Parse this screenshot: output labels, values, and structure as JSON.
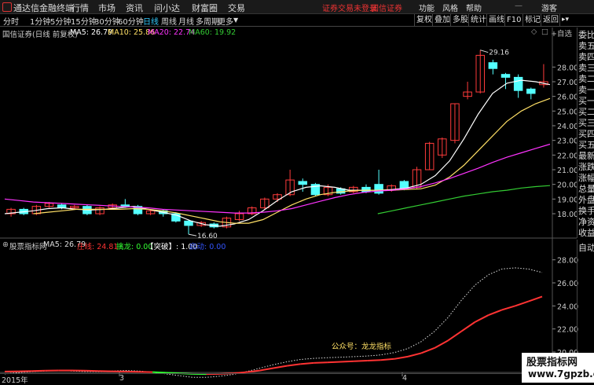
{
  "titlebar": {
    "app_name": "通达信金融终端",
    "menus": [
      "行情",
      "市场",
      "资讯",
      "问小达",
      "财富圈",
      "交易"
    ],
    "login_notice": "证券交易未登录",
    "broker": "国信证券",
    "right_items": [
      "功能",
      "风格",
      "帮助",
      "游客"
    ],
    "accent": "#e33333"
  },
  "toolbar": {
    "periods": [
      "分时",
      "1分钟",
      "5分钟",
      "15分钟",
      "30分钟",
      "60分钟",
      "日线",
      "周线",
      "月线",
      "多周期",
      "更多"
    ],
    "active_period": "日线",
    "right_buttons": [
      "复权",
      "叠加",
      "多股",
      "统计",
      "画线",
      "F10",
      "标记",
      "返回"
    ]
  },
  "main_chart": {
    "title": "国信证券(日线 前复权)",
    "legend": [
      {
        "label": "MA5: 26.79",
        "color": "#ffffff"
      },
      {
        "label": "MA10: 25.86",
        "color": "#ffe066"
      },
      {
        "label": "MA20: 22.74",
        "color": "#ff33ff"
      },
      {
        "label": "MA60: 19.92",
        "color": "#33cc33"
      }
    ],
    "high_label": "29.16",
    "low_label": "16.60"
  },
  "indicator_panel": {
    "title": "股票指标网",
    "legend": [
      {
        "label": "MA5: 26.79",
        "color": "#dddddd"
      },
      {
        "label": "庄线: 24.81",
        "color": "#ff3333"
      },
      {
        "label": "擒龙: 0.00",
        "color": "#33ff33"
      },
      {
        "label": "【突破】: 1.00",
        "color": "#ffffff"
      },
      {
        "label": "启动: 0.00",
        "color": "#3355ff"
      }
    ],
    "annotation": "公众号：龙龙指标"
  },
  "sidebar": {
    "items": [
      "委比",
      "卖五",
      "卖四",
      "卖三",
      "卖二",
      "卖一",
      "买一",
      "买二",
      "买三",
      "买四",
      "买五",
      "最新",
      "涨跌",
      "涨幅",
      "总量",
      "外盘",
      "换手",
      "净资",
      "收益"
    ],
    "bottom_label": "自动"
  },
  "bottom_axis": {
    "labels": [
      "2015年",
      "3",
      "4"
    ]
  },
  "watermark": {
    "line1": "股票指标网",
    "line2": "www.7gpzb.com"
  },
  "chart_data": [
    {
      "type": "candlestick",
      "title": "国信证券(日线 前复权)",
      "ylim": [
        16.5,
        30.0
      ],
      "y_ticks": [
        18.0,
        19.0,
        20.0,
        21.0,
        22.0,
        23.0,
        24.0,
        25.0,
        26.0,
        27.0,
        28.0
      ],
      "series": [
        {
          "name": "MA5",
          "color": "#ffffff",
          "values": [
            18.0,
            18.1,
            18.2,
            18.35,
            18.4,
            18.3,
            18.25,
            18.3,
            18.4,
            18.5,
            18.3,
            18.1,
            17.9,
            17.5,
            17.25,
            17.15,
            17.3,
            17.6,
            18.2,
            18.9,
            19.5,
            19.8,
            19.9,
            19.8,
            19.6,
            19.6,
            19.6,
            19.65,
            19.75,
            20.0,
            20.6,
            21.6,
            23.1,
            24.8,
            26.2,
            26.9,
            27.1,
            27.0,
            26.8
          ]
        },
        {
          "name": "MA10",
          "color": "#ffe066",
          "values": [
            null,
            null,
            18.0,
            18.1,
            18.2,
            18.3,
            18.3,
            18.3,
            18.3,
            18.35,
            18.3,
            18.2,
            18.05,
            17.85,
            17.65,
            17.45,
            17.35,
            17.35,
            17.6,
            18.1,
            18.6,
            19.0,
            19.3,
            19.45,
            19.55,
            19.6,
            19.6,
            19.6,
            19.65,
            19.7,
            19.95,
            20.5,
            21.3,
            22.3,
            23.3,
            24.3,
            25.0,
            25.5,
            25.86
          ]
        },
        {
          "name": "MA20",
          "color": "#ff33ff",
          "values": [
            19.0,
            18.9,
            18.8,
            18.75,
            18.7,
            18.65,
            18.6,
            18.55,
            18.5,
            18.45,
            18.4,
            18.3,
            18.25,
            18.2,
            18.15,
            18.1,
            18.05,
            18.05,
            18.1,
            18.2,
            18.35,
            18.6,
            18.85,
            19.1,
            19.3,
            19.45,
            19.55,
            19.6,
            19.7,
            19.85,
            20.1,
            20.4,
            20.75,
            21.1,
            21.5,
            21.85,
            22.15,
            22.45,
            22.74
          ]
        },
        {
          "name": "MA60",
          "color": "#33cc33",
          "values": [
            null,
            null,
            null,
            null,
            null,
            null,
            null,
            null,
            null,
            null,
            null,
            null,
            null,
            null,
            null,
            null,
            null,
            null,
            null,
            null,
            null,
            null,
            null,
            null,
            null,
            null,
            18.0,
            18.2,
            18.4,
            18.6,
            18.8,
            19.0,
            19.2,
            19.35,
            19.5,
            19.6,
            19.75,
            19.85,
            19.92
          ]
        }
      ],
      "candles": [
        [
          18.0,
          18.3,
          17.8,
          18.4
        ],
        [
          18.3,
          18.0,
          17.9,
          18.4
        ],
        [
          18.0,
          18.5,
          17.9,
          18.6
        ],
        [
          18.5,
          18.7,
          18.4,
          18.8
        ],
        [
          18.6,
          18.4,
          18.3,
          18.7
        ],
        [
          18.4,
          18.5,
          18.3,
          18.6
        ],
        [
          18.5,
          18.0,
          17.9,
          18.6
        ],
        [
          18.0,
          18.4,
          17.9,
          18.5
        ],
        [
          18.4,
          18.6,
          18.3,
          18.7
        ],
        [
          18.6,
          18.5,
          18.4,
          19.0
        ],
        [
          18.5,
          18.0,
          17.9,
          18.6
        ],
        [
          18.0,
          18.2,
          17.9,
          18.3
        ],
        [
          18.2,
          18.0,
          17.8,
          18.3
        ],
        [
          18.0,
          17.5,
          17.4,
          18.1
        ],
        [
          17.5,
          17.2,
          16.6,
          17.6
        ],
        [
          17.2,
          17.4,
          17.1,
          17.5
        ],
        [
          17.3,
          17.1,
          17.0,
          17.4
        ],
        [
          17.1,
          17.7,
          17.0,
          17.8
        ],
        [
          17.6,
          18.0,
          17.5,
          18.2
        ],
        [
          18.0,
          18.4,
          17.9,
          18.5
        ],
        [
          18.4,
          19.0,
          18.3,
          19.1
        ],
        [
          19.0,
          19.3,
          18.8,
          19.4
        ],
        [
          19.3,
          20.3,
          19.2,
          21.0
        ],
        [
          20.2,
          20.0,
          19.5,
          20.4
        ],
        [
          20.0,
          19.3,
          19.2,
          20.1
        ],
        [
          19.3,
          19.8,
          19.2,
          20.0
        ],
        [
          19.7,
          19.4,
          19.3,
          19.8
        ],
        [
          19.5,
          19.8,
          19.4,
          19.9
        ],
        [
          19.8,
          19.5,
          19.4,
          20.0
        ],
        [
          20.0,
          19.4,
          19.3,
          21.0
        ],
        [
          19.6,
          19.9,
          19.5,
          20.0
        ],
        [
          20.2,
          19.7,
          19.6,
          20.3
        ],
        [
          19.8,
          21.0,
          19.7,
          21.2
        ],
        [
          21.0,
          22.8,
          21.0,
          22.9
        ],
        [
          22.0,
          23.1,
          21.8,
          23.2
        ],
        [
          23.0,
          25.5,
          22.8,
          25.5
        ],
        [
          26.0,
          26.3,
          25.8,
          27.0
        ],
        [
          26.3,
          28.8,
          26.2,
          29.16
        ],
        [
          28.3,
          27.9,
          27.5,
          28.5
        ],
        [
          27.5,
          27.3,
          26.5,
          27.6
        ],
        [
          27.3,
          26.4,
          25.9,
          27.5
        ],
        [
          26.5,
          26.2,
          25.8,
          26.6
        ],
        [
          26.8,
          27.0,
          26.6,
          28.2
        ]
      ],
      "candle_field_order": [
        "open",
        "close",
        "low",
        "high"
      ]
    },
    {
      "type": "line",
      "title": "股票指标网",
      "ylim": [
        18.5,
        29.0
      ],
      "y_ticks": [
        20.0,
        22.0,
        24.0,
        26.0,
        28.0
      ],
      "series": [
        {
          "name": "MA5",
          "color": "#dddddd",
          "values": [
            18.1,
            18.2,
            18.3,
            18.35,
            18.4,
            18.35,
            18.3,
            18.3,
            18.35,
            18.4,
            18.35,
            18.25,
            18.1,
            17.95,
            17.8,
            17.8,
            17.9,
            18.05,
            18.3,
            18.6,
            18.9,
            19.15,
            19.35,
            19.45,
            19.5,
            19.55,
            19.6,
            19.65,
            19.75,
            19.95,
            20.3,
            20.9,
            21.8,
            23.0,
            24.5,
            25.8,
            26.7,
            27.2,
            27.3,
            27.2,
            26.9
          ]
        },
        {
          "name": "庄线",
          "color": "#ff3333",
          "values": [
            18.3,
            18.32,
            18.35,
            18.38,
            18.4,
            18.4,
            18.38,
            18.35,
            18.32,
            18.3,
            18.28,
            18.25,
            18.2,
            18.15,
            18.1,
            18.08,
            18.1,
            18.15,
            18.25,
            18.4,
            18.6,
            18.8,
            18.95,
            19.05,
            19.1,
            19.15,
            19.2,
            19.25,
            19.3,
            19.4,
            19.6,
            19.9,
            20.35,
            21.0,
            21.8,
            22.6,
            23.2,
            23.65,
            24.0,
            24.4,
            24.81
          ]
        }
      ]
    }
  ]
}
